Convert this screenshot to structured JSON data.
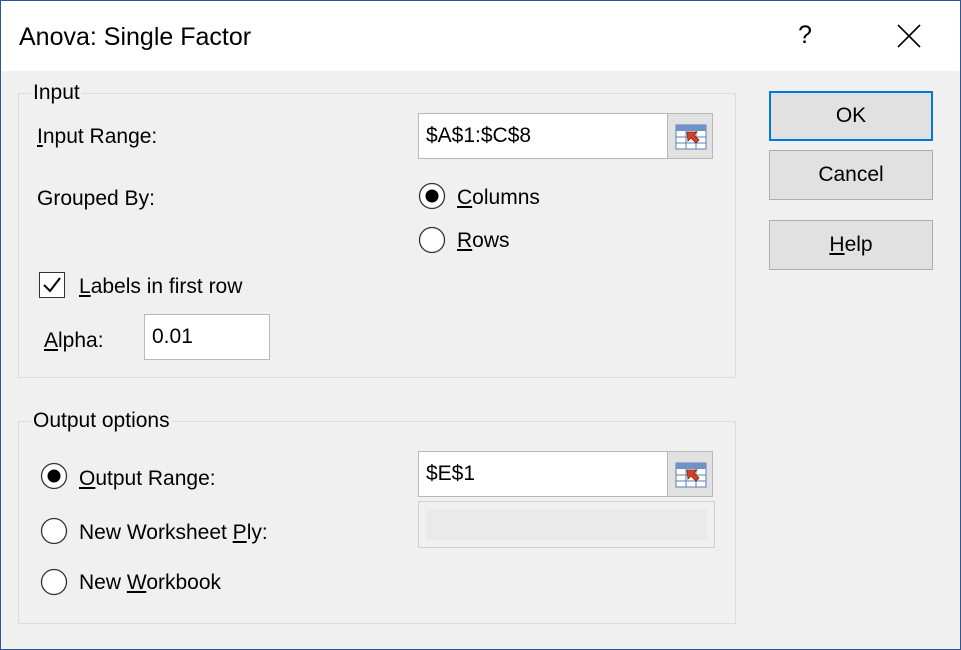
{
  "title": "Anova: Single Factor",
  "title_help": "?",
  "input_group": {
    "legend": "Input",
    "input_range": {
      "label_ul": "I",
      "label_rest": "nput Range:",
      "value": "$A$1:$C$8"
    },
    "grouped_by": {
      "label": "Grouped By:",
      "columns": {
        "ul": "C",
        "rest": "olumns",
        "selected": true
      },
      "rows": {
        "ul": "R",
        "rest": "ows",
        "selected": false
      }
    },
    "labels_first_row": {
      "ul": "L",
      "rest": "abels in first row",
      "checked": true
    },
    "alpha": {
      "ul": "A",
      "rest": "lpha:",
      "value": "0.01"
    }
  },
  "output_group": {
    "legend": "Output options",
    "output_range": {
      "ul": "O",
      "rest": "utput Range:",
      "value": "$E$1",
      "selected": true
    },
    "new_worksheet": {
      "pre": "New Worksheet ",
      "ul": "P",
      "rest": "ly:",
      "value": "",
      "selected": false
    },
    "new_workbook": {
      "pre": "New ",
      "ul": "W",
      "rest": "orkbook",
      "selected": false
    }
  },
  "buttons": {
    "ok": "OK",
    "cancel": "Cancel",
    "help_ul": "H",
    "help_rest": "elp"
  },
  "colors": {
    "accent": "#0078d7",
    "border": "#2b579a"
  }
}
